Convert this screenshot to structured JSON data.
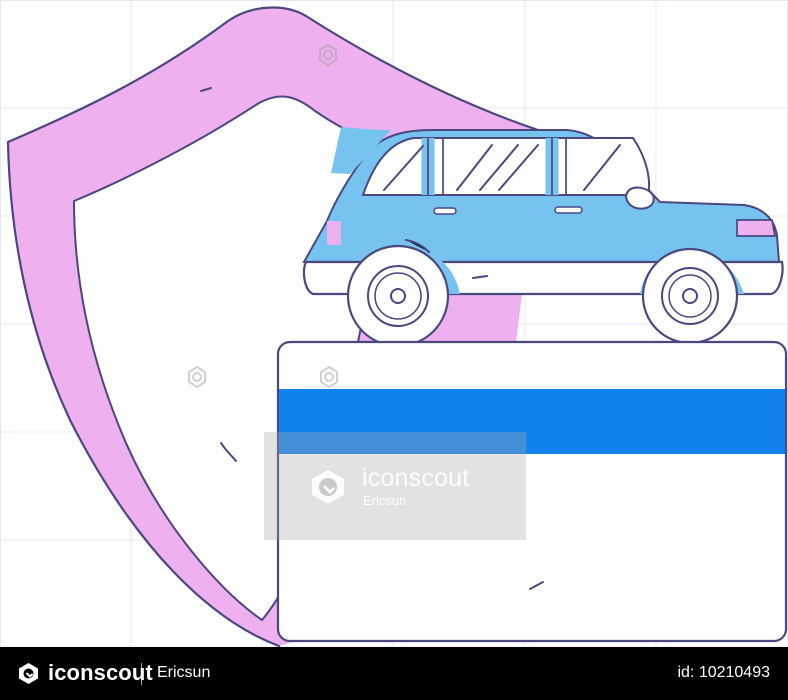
{
  "watermark": {
    "brand": "iconscout",
    "author": "Ericsun",
    "icon": "iconscout-logo-icon"
  },
  "footer": {
    "brand": "iconscout",
    "author": "Ericsun",
    "asset_id": "id: 10210493",
    "icon": "iconscout-logo-icon"
  },
  "illustration": {
    "subject": "shield with car above a payment card",
    "colors": {
      "shield": "#efb0ef",
      "car": "#77c3ef",
      "card_stripe": "#1282ee",
      "outline": "#4b477f",
      "grid": "#e3e8f3",
      "wheel": "#ffffff"
    },
    "icons": [
      "shield-icon",
      "car-icon",
      "credit-card-icon"
    ]
  }
}
